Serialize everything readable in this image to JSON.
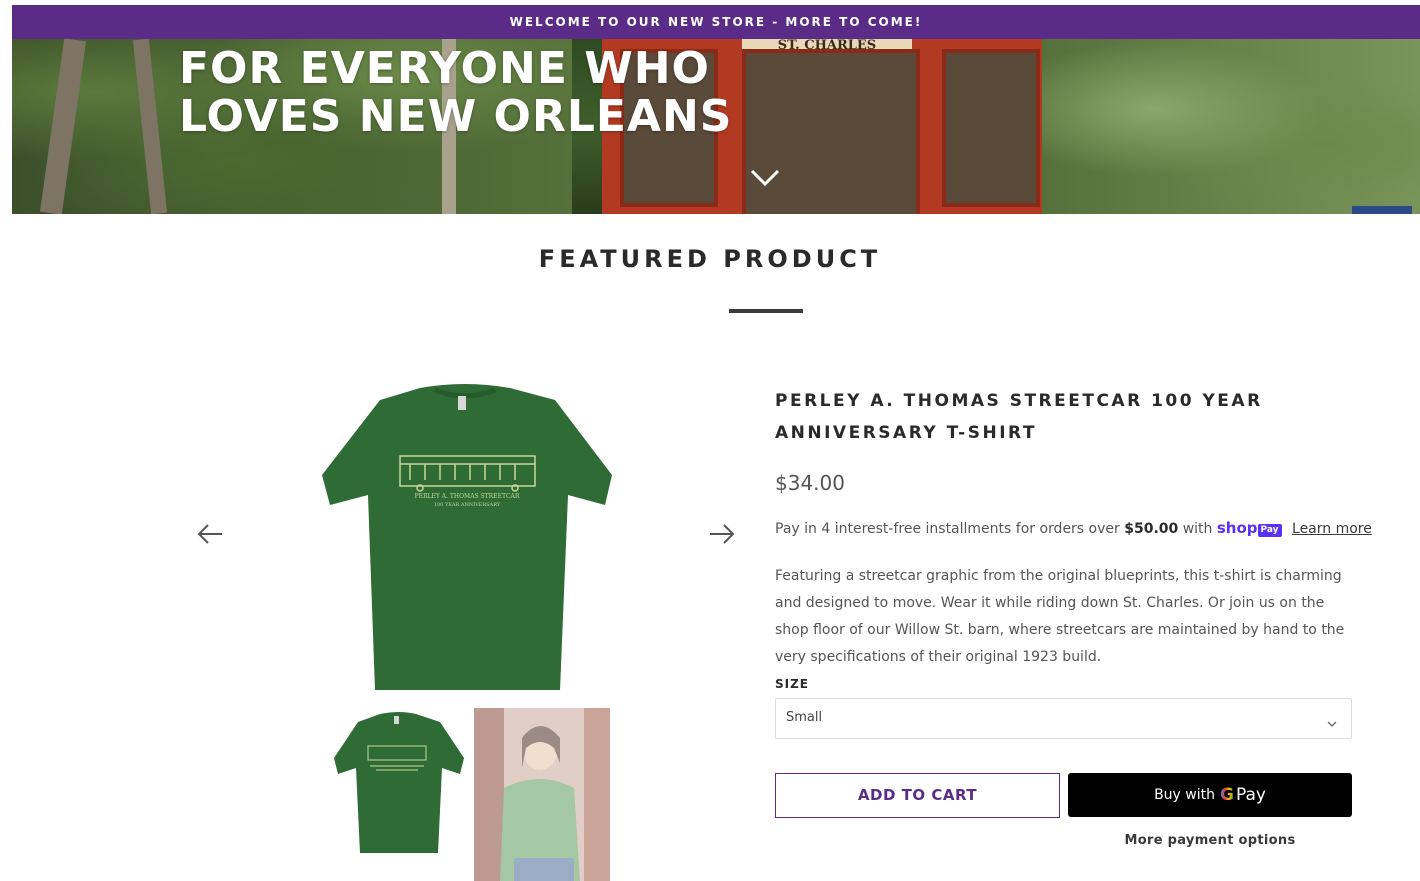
{
  "announcement": {
    "text": "WELCOME TO OUR NEW STORE - MORE TO COME!",
    "bg_color": "#5b2c87"
  },
  "hero": {
    "headline_line1": "FOR EVERYONE WHO",
    "headline_line2": "LOVES NEW ORLEANS",
    "sign_text": "ST. CHARLES",
    "scroll_icon": "chevron-down-icon"
  },
  "featured": {
    "title": "FEATURED PRODUCT"
  },
  "product": {
    "title": "PERLEY A. THOMAS STREETCAR 100 YEAR ANNIVERSARY T-SHIRT",
    "price": "$34.00",
    "installments": {
      "prefix": "Pay in 4 interest-free installments for orders over",
      "amount": "$50.00",
      "with": "with",
      "shop_logo": "shop",
      "pay_badge": "Pay",
      "learn_more": "Learn more"
    },
    "description": "Featuring a streetcar graphic from the original blueprints, this t-shirt is charming and designed to move. Wear it while riding down St. Charles. Or join us on the shop floor of our Willow St. barn, where streetcars are maintained by hand to the very specifications of their original 1923 build.",
    "size_label": "SIZE",
    "size_selected": "Small",
    "shirt_print_line1": "PERLEY A. THOMAS STREETCAR",
    "shirt_print_line2": "100 YEAR ANNIVERSARY",
    "shirt_color": "#2f6b35"
  },
  "buttons": {
    "add_to_cart": "ADD TO CART",
    "gpay_prefix": "Buy with",
    "gpay_g": "G",
    "gpay_pay": "Pay",
    "more_options": "More payment options"
  },
  "nav": {
    "prev_icon": "arrow-left-icon",
    "next_icon": "arrow-right-icon"
  },
  "colors": {
    "brand_purple": "#5b2c87",
    "shop_pay": "#5a31f4"
  }
}
